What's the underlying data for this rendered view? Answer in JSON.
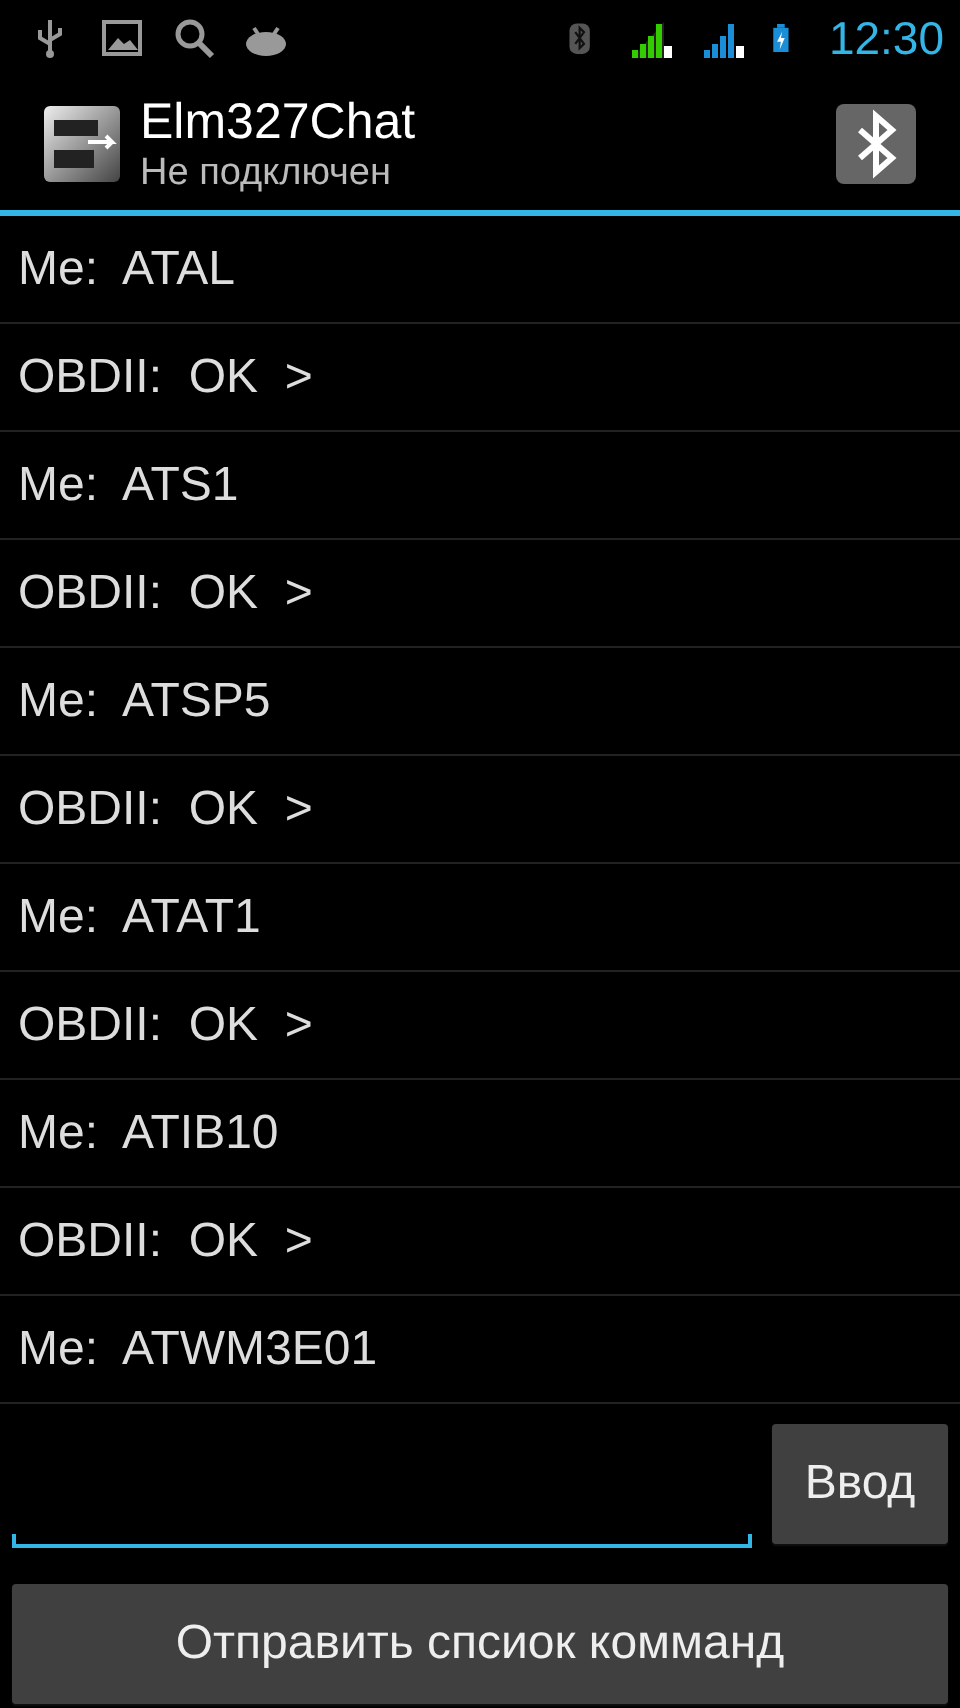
{
  "status_bar": {
    "time": "12:30"
  },
  "action_bar": {
    "title": "Elm327Chat",
    "subtitle": "Не подключен"
  },
  "messages": [
    "Me:  ATAL",
    "OBDII:  OK  >",
    "Me:  ATS1",
    "OBDII:  OK  >",
    "Me:  ATSP5",
    "OBDII:  OK  >",
    "Me:  ATAT1",
    "OBDII:  OK  >",
    "Me:  ATIB10",
    "OBDII:  OK  >",
    "Me:  ATWM3E01"
  ],
  "input": {
    "button": "Ввод"
  },
  "send_list_button": "Отправить спсиок комманд"
}
